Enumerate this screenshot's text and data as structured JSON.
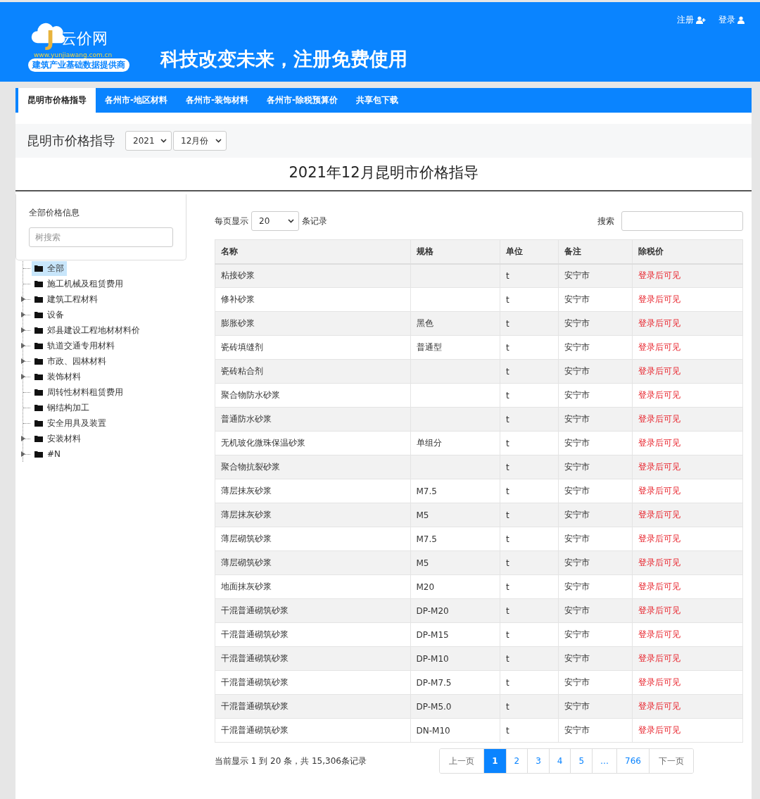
{
  "header": {
    "logo": {
      "mark": "J",
      "name": "云价网",
      "url": "www.yunjiawang.com.cn",
      "tagline": "建筑产业基础数据提供商"
    },
    "slogan": "科技改变未来，注册免费使用",
    "links": [
      {
        "label": "注册",
        "kind": "register"
      },
      {
        "label": "登录",
        "kind": "login"
      }
    ]
  },
  "tabs": [
    {
      "label": "昆明市价格指导",
      "selected": true
    },
    {
      "label": "各州市-地区材料",
      "selected": false
    },
    {
      "label": "各州市-装饰材料",
      "selected": false
    },
    {
      "label": "各州市-除税预算价",
      "selected": false
    },
    {
      "label": "共享包下载",
      "selected": false
    }
  ],
  "filter": {
    "title": "昆明市价格指导",
    "year": "2021",
    "month": "12月份"
  },
  "page_title": "2021年12月昆明市价格指导",
  "sidebar": {
    "title": "全部价格信息",
    "search_placeholder": "树搜索",
    "items": [
      {
        "label": "全部",
        "selected": true,
        "expandable": false
      },
      {
        "label": "施工机械及租赁费用",
        "selected": false,
        "expandable": false
      },
      {
        "label": "建筑工程材料",
        "selected": false,
        "expandable": true
      },
      {
        "label": "设备",
        "selected": false,
        "expandable": true
      },
      {
        "label": "郊县建设工程地材材料价",
        "selected": false,
        "expandable": true
      },
      {
        "label": "轨道交通专用材料",
        "selected": false,
        "expandable": true
      },
      {
        "label": "市政、园林材料",
        "selected": false,
        "expandable": true
      },
      {
        "label": "装饰材料",
        "selected": false,
        "expandable": true
      },
      {
        "label": "周转性材料租赁费用",
        "selected": false,
        "expandable": false
      },
      {
        "label": "钢结构加工",
        "selected": false,
        "expandable": false
      },
      {
        "label": "安全用具及装置",
        "selected": false,
        "expandable": false
      },
      {
        "label": "安装材料",
        "selected": false,
        "expandable": true
      },
      {
        "label": "#N",
        "selected": false,
        "expandable": true
      }
    ]
  },
  "table": {
    "page_size_label_before": "每页显示",
    "page_size": "20",
    "page_size_label_after": "条记录",
    "search_label": "搜索",
    "columns": [
      "名称",
      "规格",
      "单位",
      "备注",
      "除税价"
    ],
    "rows": [
      [
        "粘接砂浆",
        "",
        "t",
        "安宁市",
        "登录后可见"
      ],
      [
        "修补砂浆",
        "",
        "t",
        "安宁市",
        "登录后可见"
      ],
      [
        "膨胀砂浆",
        "黑色",
        "t",
        "安宁市",
        "登录后可见"
      ],
      [
        "瓷砖填缝剂",
        "普通型",
        "t",
        "安宁市",
        "登录后可见"
      ],
      [
        "瓷砖粘合剂",
        "",
        "t",
        "安宁市",
        "登录后可见"
      ],
      [
        "聚合物防水砂浆",
        "",
        "t",
        "安宁市",
        "登录后可见"
      ],
      [
        "普通防水砂浆",
        "",
        "t",
        "安宁市",
        "登录后可见"
      ],
      [
        "无机玻化微珠保温砂浆",
        "单组分",
        "t",
        "安宁市",
        "登录后可见"
      ],
      [
        "聚合物抗裂砂浆",
        "",
        "t",
        "安宁市",
        "登录后可见"
      ],
      [
        "薄层抹灰砂浆",
        "M7.5",
        "t",
        "安宁市",
        "登录后可见"
      ],
      [
        "薄层抹灰砂浆",
        "M5",
        "t",
        "安宁市",
        "登录后可见"
      ],
      [
        "薄层砌筑砂浆",
        "M7.5",
        "t",
        "安宁市",
        "登录后可见"
      ],
      [
        "薄层砌筑砂浆",
        "M5",
        "t",
        "安宁市",
        "登录后可见"
      ],
      [
        "地面抹灰砂浆",
        "M20",
        "t",
        "安宁市",
        "登录后可见"
      ],
      [
        "干混普通砌筑砂浆",
        "DP-M20",
        "t",
        "安宁市",
        "登录后可见"
      ],
      [
        "干混普通砌筑砂浆",
        "DP-M15",
        "t",
        "安宁市",
        "登录后可见"
      ],
      [
        "干混普通砌筑砂浆",
        "DP-M10",
        "t",
        "安宁市",
        "登录后可见"
      ],
      [
        "干混普通砌筑砂浆",
        "DP-M7.5",
        "t",
        "安宁市",
        "登录后可见"
      ],
      [
        "干混普通砌筑砂浆",
        "DP-M5.0",
        "t",
        "安宁市",
        "登录后可见"
      ],
      [
        "干混普通砌筑砂浆",
        "DN-M10",
        "t",
        "安宁市",
        "登录后可见"
      ]
    ],
    "info": "当前显示 1 到 20 条，共 15,306条记录",
    "pages": [
      {
        "label": "上一页",
        "selected": false
      },
      {
        "label": "1",
        "selected": true
      },
      {
        "label": "2",
        "selected": false
      },
      {
        "label": "3",
        "selected": false
      },
      {
        "label": "4",
        "selected": false
      },
      {
        "label": "5",
        "selected": false
      },
      {
        "label": "…",
        "selected": false
      },
      {
        "label": "766",
        "selected": false
      },
      {
        "label": "下一页",
        "selected": false
      }
    ]
  }
}
